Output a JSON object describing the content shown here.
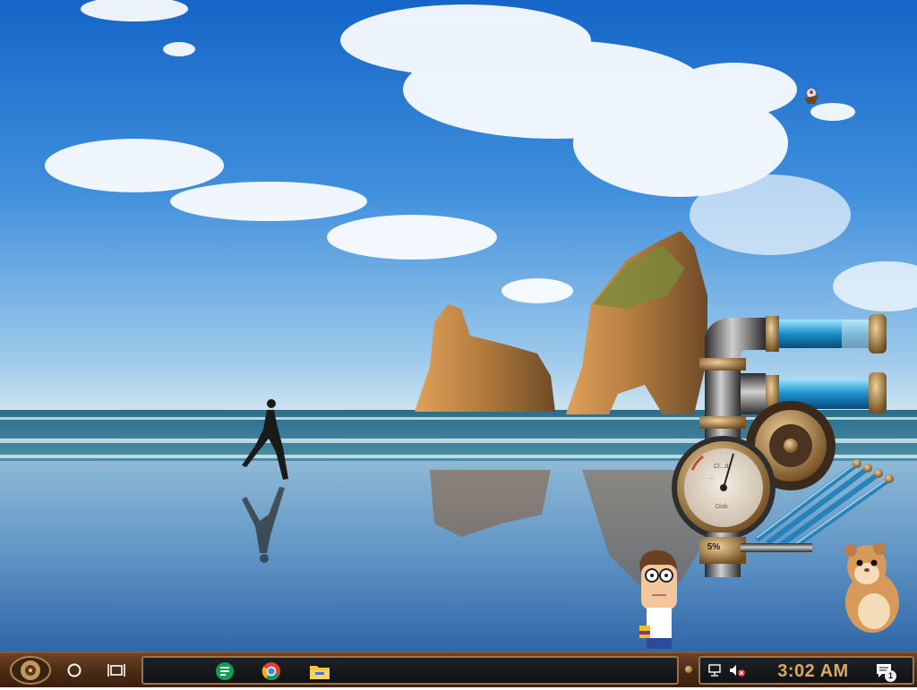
{
  "desktop": {
    "wallpaper": "beach-runner-rocks",
    "gauge_widget": {
      "label_top": "Cl...d",
      "label_mid": "...",
      "label_bottom": "Disk",
      "percent": "5%"
    }
  },
  "taskbar": {
    "start_icon": "steampunk-gear-icon",
    "cortana_icon": "circle-icon",
    "taskview_icon": "task-view-icon",
    "pinned_apps": [
      {
        "name": "Google Sheets",
        "icon": "sheets-icon"
      },
      {
        "name": "Google Chrome",
        "icon": "chrome-icon"
      },
      {
        "name": "File Explorer",
        "icon": "folder-icon"
      }
    ],
    "tray": {
      "clock": "3:02 AM",
      "notification_count": "1"
    }
  },
  "colors": {
    "clock": "#d9a95c",
    "taskbar_wood": "#5a3419",
    "tray_border": "#9a7448"
  }
}
